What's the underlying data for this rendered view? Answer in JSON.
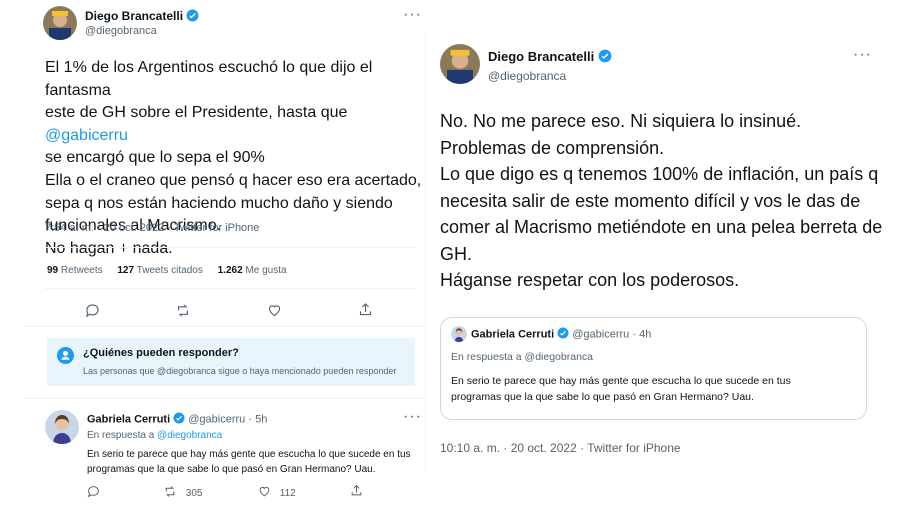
{
  "left_tweet": {
    "author_name": "Diego Brancatelli",
    "author_handle": "@diegobranca",
    "lines": [
      {
        "pre": "El 1% de los Argentinos escuchó lo que dijo el fantasma"
      },
      {
        "pre": "este de GH sobre el Presidente, hasta que ",
        "mention": "@gabicerru"
      },
      {
        "pre": "se encargó que lo sepa el 90%"
      },
      {
        "pre": "Ella o el craneo que pensó q hacer eso era acertado,"
      },
      {
        "pre": "sepa q nos están haciendo mucho daño y siendo"
      },
      {
        "pre": "funcionales al Macrismo."
      },
      {
        "pre": "No hagan + nada."
      }
    ],
    "timestamp": "7:54 a. m. · 20 oct. 2022 · Twitter for iPhone",
    "stats": [
      {
        "num": "99",
        "label": "Retweets"
      },
      {
        "num": "127",
        "label": "Tweets citados"
      },
      {
        "num": "1.262",
        "label": "Me gusta"
      }
    ],
    "actions": [
      "reply-icon",
      "retweet-icon",
      "like-icon",
      "share-icon"
    ]
  },
  "who_can_reply": {
    "title": "¿Quiénes pueden responder?",
    "body": "Las personas que @diegobranca sigue o haya mencionado pueden responder"
  },
  "reply": {
    "author_name": "Gabriela Cerruti",
    "author_handle": "@gabicerru",
    "time": "· 5h",
    "replying_prefix": "En respuesta a ",
    "replying_to": "@diegobranca",
    "line1": "En serio te parece que hay más gente que escucha lo que sucede en tus",
    "line2": "programas que la que sabe lo que pasó en Gran Hermano? Uau.",
    "retweets": "305",
    "likes": "112"
  },
  "right_tweet": {
    "author_name": "Diego Brancatelli",
    "author_handle": "@diegobranca",
    "lines": [
      "No. No me parece eso. Ni siquiera lo insinué.",
      "Problemas de comprensión.",
      "Lo que digo es q tenemos 100% de inflación, un país q",
      "necesita salir de este momento difícil y vos le das de",
      "comer al Macrismo metiéndote en una pelea berreta de",
      "GH.",
      "Háganse respetar con los poderosos."
    ],
    "timestamp": "10:10 a. m. · 20 oct. 2022 · Twitter for iPhone"
  },
  "quoted": {
    "author_name": "Gabriela Cerruti",
    "author_handle": "@gabicerru",
    "time": "· 4h",
    "replying": "En respuesta a @diegobranca",
    "line1": "En serio te parece que hay más gente que escucha lo que sucede en tus",
    "line2": "programas que la que sabe lo que pasó en Gran Hermano? Uau."
  },
  "colors": {
    "accent": "#1d9bf0",
    "text": "#0f1419",
    "secondary": "#536471",
    "banner": "#e8f5fd"
  }
}
